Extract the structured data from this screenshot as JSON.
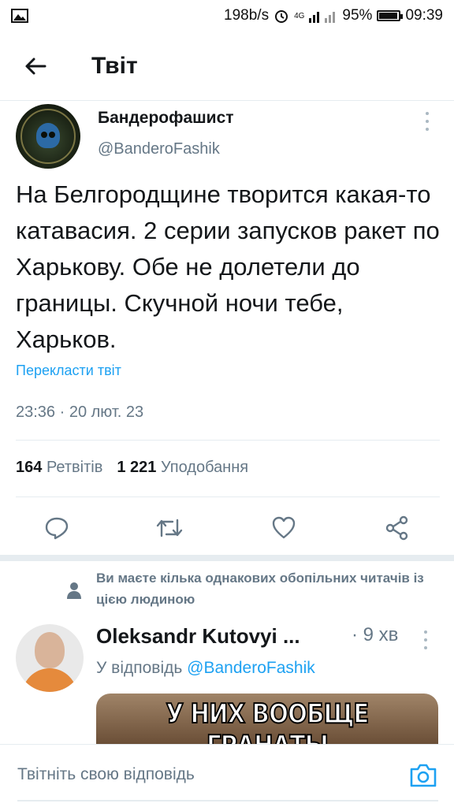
{
  "status_bar": {
    "net_speed": "198b/s",
    "signal": "4G",
    "battery": "95%",
    "battery_level": 0.95,
    "time": "09:39"
  },
  "header": {
    "title": "Твіт"
  },
  "tweet": {
    "author_name": "Бандерофашист",
    "author_handle": "@BanderoFashik",
    "text": "На Белгородщине творится какая-то катавасия. 2  серии запусков ракет по Харькову. Обе не долетели до границы. Скучной ночи тебе, Харьков.",
    "translate_label": "Перекласти твіт",
    "timestamp": "23:36 · 20 лют. 23",
    "retweets_count": "164",
    "retweets_label": "Ретвітів",
    "likes_count": "1 221",
    "likes_label": "Уподобання"
  },
  "notice": {
    "text": "Ви маєте кілька однакових обопільних читачів із цією людиною"
  },
  "reply": {
    "author_name": "Oleksandr Kutovyi ...",
    "time": "· 9 хв",
    "reply_prefix": "У відповідь",
    "reply_handle": "@BanderoFashik",
    "media_caption": "У НИХ ВООБЩЕ ГРАНАТЫ"
  },
  "compose": {
    "placeholder": "Твітніть свою відповідь"
  },
  "colors": {
    "accent": "#1da1f2",
    "muted": "#657786",
    "text": "#14171a",
    "divider": "#e6ecf0"
  },
  "icons": [
    "image-icon",
    "alarm-icon",
    "signal-icon",
    "battery-icon",
    "back-arrow-icon",
    "more-vertical-icon",
    "reply-icon",
    "retweet-icon",
    "like-icon",
    "share-icon",
    "person-icon",
    "camera-icon"
  ]
}
